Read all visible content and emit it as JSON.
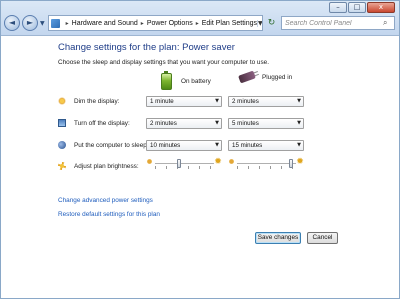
{
  "window": {
    "controls": {
      "minimize": "–",
      "maximize": "□",
      "close": "x"
    }
  },
  "nav": {
    "back_icon": "◄",
    "forward_icon": "►",
    "dropdown_icon": "▼",
    "breadcrumb": [
      "Hardware and Sound",
      "Power Options",
      "Edit Plan Settings"
    ],
    "separator": "▸",
    "refresh_icon": "↻",
    "search_placeholder": "Search Control Panel",
    "search_icon": "⌕"
  },
  "page": {
    "title": "Change settings for the plan: Power saver",
    "subtitle": "Choose the sleep and display settings that you want your computer to use."
  },
  "columns": {
    "battery": "On battery",
    "plugged": "Plugged in"
  },
  "settings": [
    {
      "label": "Dim the display:",
      "icon": "sun-dim-icon",
      "battery": "1 minute",
      "plugged": "2 minutes"
    },
    {
      "label": "Turn off the display:",
      "icon": "monitor-icon",
      "battery": "2 minutes",
      "plugged": "5 minutes"
    },
    {
      "label": "Put the computer to sleep:",
      "icon": "sleep-moon-icon",
      "battery": "10 minutes",
      "plugged": "15 minutes"
    }
  ],
  "brightness": {
    "label": "Adjust plan brightness:",
    "battery_level": 0.4,
    "plugged_level": 0.95
  },
  "links": {
    "advanced": "Change advanced power settings",
    "restore": "Restore default settings for this plan"
  },
  "buttons": {
    "save": "Save changes",
    "cancel": "Cancel"
  },
  "colors": {
    "title": "#1f3d88",
    "link": "#1f5dbd"
  }
}
